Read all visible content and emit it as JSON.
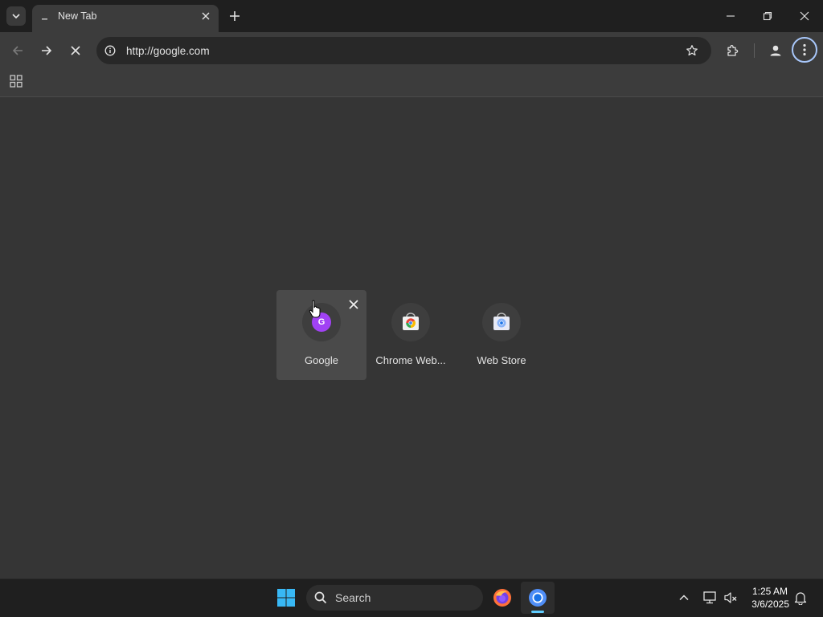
{
  "browser": {
    "tab": {
      "title": "New Tab"
    },
    "omnibox": {
      "url": "http://google.com"
    }
  },
  "shortcuts": [
    {
      "label": "Google",
      "favicon_letter": "G"
    },
    {
      "label": "Chrome Web..."
    },
    {
      "label": "Web Store"
    }
  ],
  "taskbar": {
    "search_label": "Search",
    "time": "1:25 AM",
    "date": "3/6/2025"
  },
  "colors": {
    "accent": "#a8c7fa",
    "google_favicon_bg": "#a142f4",
    "taskbar_indicator": "#60cdff"
  }
}
